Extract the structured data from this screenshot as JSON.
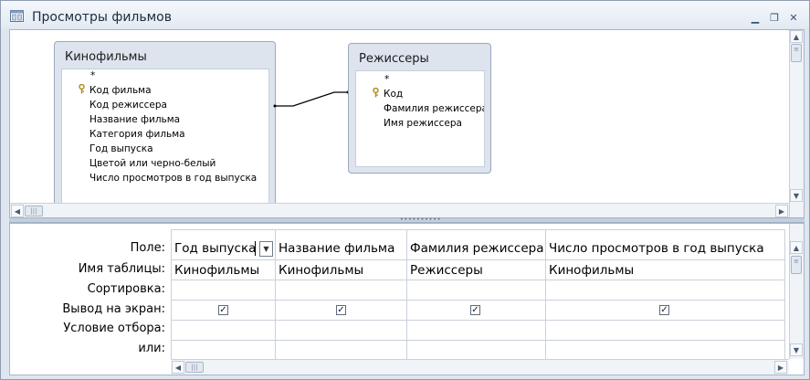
{
  "window": {
    "title": "Просмотры фильмов",
    "minimize_glyph": "▁",
    "restore_glyph": "❐",
    "close_glyph": "✕"
  },
  "tables": [
    {
      "title": "Кинофильмы",
      "fields": [
        {
          "name": "*",
          "key": false
        },
        {
          "name": "Код фильма",
          "key": true
        },
        {
          "name": "Код режиссера",
          "key": false
        },
        {
          "name": "Название  фильма",
          "key": false
        },
        {
          "name": "Категория  фильма",
          "key": false
        },
        {
          "name": "Год выпуска",
          "key": false
        },
        {
          "name": "Цветой или черно-белый",
          "key": false
        },
        {
          "name": "Число просмотров в год выпуска",
          "key": false
        }
      ]
    },
    {
      "title": "Режиссеры",
      "fields": [
        {
          "name": "*",
          "key": false
        },
        {
          "name": "Код",
          "key": true
        },
        {
          "name": "Фамилия режиссера",
          "key": false
        },
        {
          "name": "Имя режиссера",
          "key": false
        }
      ]
    }
  ],
  "grid": {
    "row_labels": [
      "Поле:",
      "Имя таблицы:",
      "Сортировка:",
      "Вывод на экран:",
      "Условие отбора:",
      "или:"
    ],
    "columns": [
      {
        "field": "Год выпуска",
        "table": "Кинофильмы",
        "sort": "",
        "show": true
      },
      {
        "field": "Название  фильма",
        "table": "Кинофильмы",
        "sort": "",
        "show": true
      },
      {
        "field": "Фамилия режиссера",
        "table": "Режиссеры",
        "sort": "",
        "show": true
      },
      {
        "field": "Число просмотров в год выпуска",
        "table": "Кинофильмы",
        "sort": "",
        "show": true
      }
    ]
  },
  "icons": {
    "key": "key-icon",
    "window": "query-window-icon",
    "dropdown": "chevron-down-icon"
  },
  "colors": {
    "frame": "#dfe6ef",
    "table_header": "#dde4ee",
    "grid_line": "#c9d1db"
  }
}
